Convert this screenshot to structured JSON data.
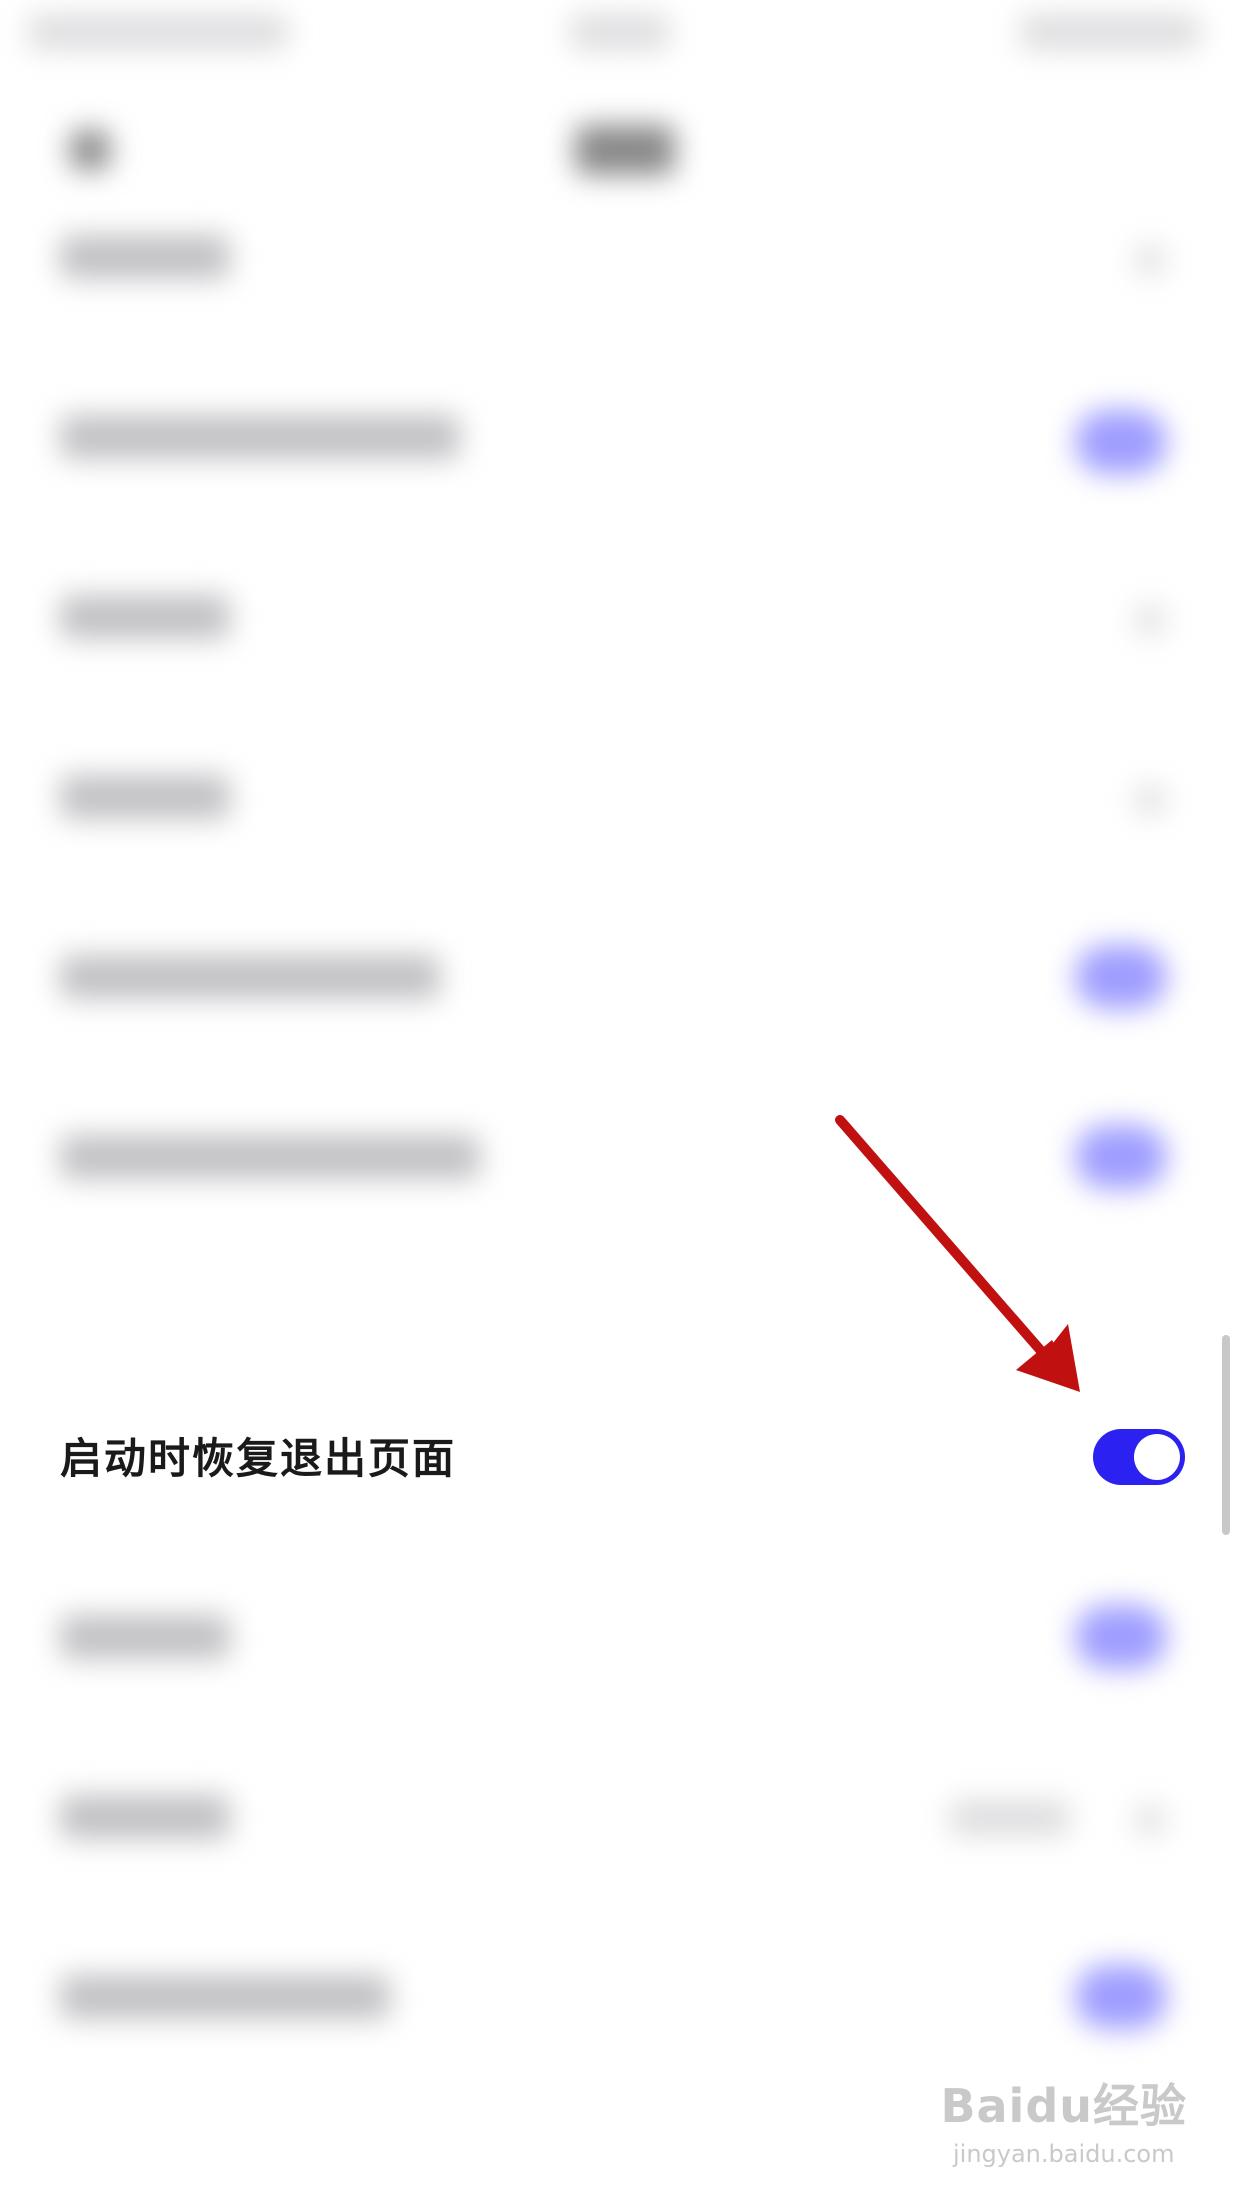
{
  "setting": {
    "label": "启动时恢复退出页面",
    "toggle_state": "on"
  },
  "colors": {
    "accent": "#2b21f0",
    "arrow": "#c01010"
  },
  "watermark": {
    "brand": "Baidu经验",
    "url": "jingyan.baidu.com"
  }
}
